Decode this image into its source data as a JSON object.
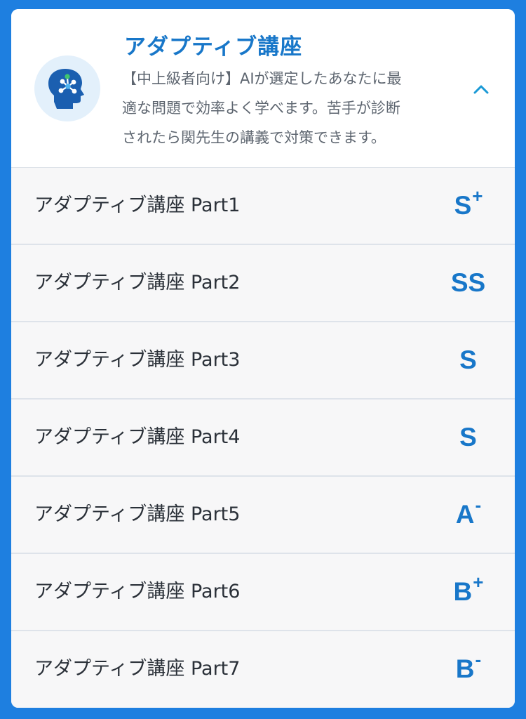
{
  "course": {
    "title": "アダプティブ講座",
    "description_lines": [
      "【中上級者向け】AIが選定したあなたに最",
      "適な問題で効率よく学べます。苦手が診断",
      "されたら関先生の講義で対策できます。"
    ],
    "icon": "brain-head-icon",
    "toggle_icon": "chevron-up-icon"
  },
  "parts": [
    {
      "label": "アダプティブ講座 Part1",
      "grade": "S",
      "modifier": "+"
    },
    {
      "label": "アダプティブ講座 Part2",
      "grade": "SS",
      "modifier": ""
    },
    {
      "label": "アダプティブ講座 Part3",
      "grade": "S",
      "modifier": ""
    },
    {
      "label": "アダプティブ講座 Part4",
      "grade": "S",
      "modifier": ""
    },
    {
      "label": "アダプティブ講座 Part5",
      "grade": "A",
      "modifier": "-"
    },
    {
      "label": "アダプティブ講座 Part6",
      "grade": "B",
      "modifier": "+"
    },
    {
      "label": "アダプティブ講座 Part7",
      "grade": "B",
      "modifier": "-"
    }
  ],
  "colors": {
    "background": "#1e7fe0",
    "accent": "#1877c9",
    "icon_bg": "#e3f0fb",
    "row_bg": "#f7f7f8"
  }
}
